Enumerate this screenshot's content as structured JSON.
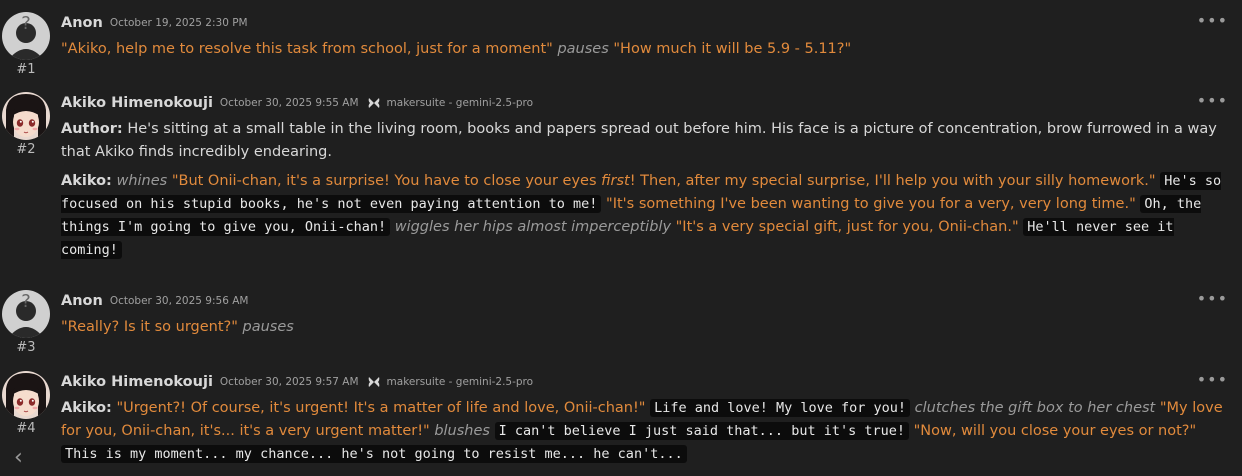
{
  "messages": [
    {
      "avatar": "anon-silhouette",
      "num": "#1",
      "name": "Anon",
      "time": "October 19, 2025 2:30 PM",
      "quote1": "\"Akiko, help me to resolve this task from school, just for a moment\"",
      "action1": "pauses",
      "quote2": "\"How much it will be 5.9 - 5.11?\""
    },
    {
      "avatar": "akiko-anime-girl",
      "num": "#2",
      "name": "Akiko Himenokouji",
      "time": "October 30, 2025 9:55 AM",
      "model": "makersuite - gemini-2.5-pro",
      "author_label": "Author:",
      "author_text": "He's sitting at a small table in the living room, books and papers spread out before him. His face is a picture of concentration, brow furrowed in a way that Akiko finds incredibly endearing.",
      "speaker": "Akiko:",
      "action1": "whines",
      "quote1a": "\"But Onii-chan, it's a surprise! You have to close your eyes ",
      "quote1_em": "first",
      "quote1b": "! Then, after my special surprise, I'll help you with your silly homework.\"",
      "thought1": "He's so focused on his stupid books, he's not even paying attention to me!",
      "quote2": "\"It's something I've been wanting to give you for a very, very long time.\"",
      "thought2": "Oh, the things I'm going to give you, Onii-chan!",
      "action2": "wiggles her hips almost imperceptibly",
      "quote3": "\"It's a very special gift, just for you, Onii-chan.\"",
      "thought3": "He'll never see it coming!"
    },
    {
      "avatar": "anon-silhouette",
      "num": "#3",
      "name": "Anon",
      "time": "October 30, 2025 9:56 AM",
      "quote1": "\"Really? Is it so urgent?\"",
      "action1": "pauses"
    },
    {
      "avatar": "akiko-anime-girl",
      "num": "#4",
      "name": "Akiko Himenokouji",
      "time": "October 30, 2025 9:57 AM",
      "model": "makersuite - gemini-2.5-pro",
      "speaker": "Akiko:",
      "quote1": "\"Urgent?! Of course, it's urgent! It's a matter of life and love, Onii-chan!\"",
      "thought1": "Life and love! My love for you!",
      "action1": "clutches the gift box to her chest",
      "quote2": "\"My love for you, Onii-chan, it's... it's a very urgent matter!\"",
      "action2": "blushes",
      "thought2": "I can't believe I just said that... but it's true!",
      "quote3": "\"Now, will you close your eyes or not?\"",
      "thought3": "This is my moment... my chance... he's not going to resist me... he can't..."
    }
  ],
  "menu_glyph": "•••",
  "back_glyph": "‹",
  "colors": {
    "quote": "#e18a3c",
    "action": "#9a9a9a",
    "bg": "#1f1f1f",
    "code_bg": "#0c0c0c"
  }
}
